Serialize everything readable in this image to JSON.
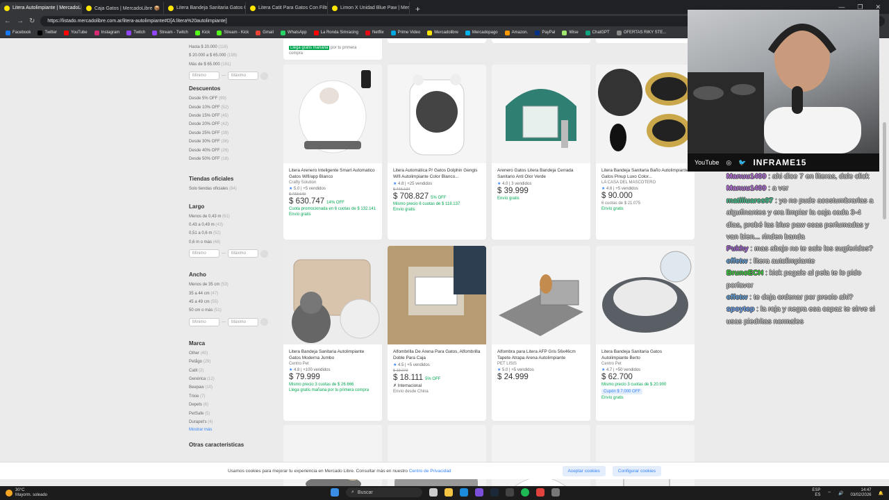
{
  "browser": {
    "tabs": [
      {
        "label": "Litera Autolimpiante | MercadoLi...",
        "active": true
      },
      {
        "label": "Caja Gatos | MercadoLibre 📦",
        "active": false
      },
      {
        "label": "Litera Bandeja Sanitaria Gatos Co...",
        "active": false
      },
      {
        "label": "Litera Catit Para Gatos Con Filtro A...",
        "active": false
      },
      {
        "label": "Limon X Unidad Blue Paw | Merca...",
        "active": false
      }
    ],
    "url": "https://listado.mercadolibre.com.ar/litera-autolimpiante#D[A:litera%20autolimpiante]",
    "bookmarks": [
      "Facebook",
      "Twitter",
      "YouTube",
      "Instagram",
      "Twitch",
      "Stream - Twitch",
      "Kick",
      "Stream - Kick",
      "Gmail",
      "WhatsApp",
      "La Ronda Simracing",
      "Netflix",
      "Prime Video",
      "Mercadolibre",
      "Mercadopago",
      "Amazon.",
      "PayPal",
      "Wise",
      "ChatGPT",
      "OFERTAS RIKY STE..."
    ],
    "bookmark_colors": [
      "#1877f2",
      "#000",
      "#f00",
      "#d62976",
      "#9146ff",
      "#9146ff",
      "#53fc18",
      "#53fc18",
      "#ea4335",
      "#25d366",
      "#f00",
      "#e50914",
      "#00a8e1",
      "#ffe600",
      "#00b1ea",
      "#ff9900",
      "#003087",
      "#9fe870",
      "#10a37f",
      "#888"
    ]
  },
  "filters": {
    "price_items": [
      {
        "label": "Hasta $ 20.000",
        "count": "(116)"
      },
      {
        "label": "$ 20.000 a $ 65.000",
        "count": "(199)"
      },
      {
        "label": "Más de $ 65.000",
        "count": "(161)"
      }
    ],
    "min_ph": "Mínimo",
    "max_ph": "Máximo",
    "discounts_title": "Descuentos",
    "discounts": [
      {
        "label": "Desde 5% OFF",
        "count": "(99)"
      },
      {
        "label": "Desde 10% OFF",
        "count": "(52)"
      },
      {
        "label": "Desde 15% OFF",
        "count": "(45)"
      },
      {
        "label": "Desde 20% OFF",
        "count": "(42)"
      },
      {
        "label": "Desde 25% OFF",
        "count": "(39)"
      },
      {
        "label": "Desde 30% OFF",
        "count": "(36)"
      },
      {
        "label": "Desde 40% OFF",
        "count": "(26)"
      },
      {
        "label": "Desde 50% OFF",
        "count": "(18)"
      }
    ],
    "official_title": "Tiendas oficiales",
    "official": {
      "label": "Solo tiendas oficiales",
      "count": "(84)"
    },
    "length_title": "Largo",
    "length": [
      {
        "label": "Menos de 0,43 m",
        "count": "(61)"
      },
      {
        "label": "0,43 a 0,49 m",
        "count": "(43)"
      },
      {
        "label": "0,51 a 0,6 m",
        "count": "(52)"
      },
      {
        "label": "0,6 m o más",
        "count": "(48)"
      }
    ],
    "width_title": "Ancho",
    "width": [
      {
        "label": "Menos de 35 cm",
        "count": "(53)"
      },
      {
        "label": "35 a 44 cm",
        "count": "(47)"
      },
      {
        "label": "45 a 49 cm",
        "count": "(55)"
      },
      {
        "label": "50 cm o más",
        "count": "(51)"
      }
    ],
    "brand_title": "Marca",
    "brands": [
      {
        "label": "Other",
        "count": "(40)"
      },
      {
        "label": "Petågo",
        "count": "(29)"
      },
      {
        "label": "Catit",
        "count": "(2)"
      },
      {
        "label": "Genérica",
        "count": "(12)"
      },
      {
        "label": "Beepaw",
        "count": "(10)"
      },
      {
        "label": "Trixie",
        "count": "(7)"
      },
      {
        "label": "Depets",
        "count": "(6)"
      },
      {
        "label": "PetSafe",
        "count": "(5)"
      },
      {
        "label": "Durapet's",
        "count": "(4)"
      }
    ],
    "more": "Mostrar más",
    "other_title": "Otras características"
  },
  "top_partial": {
    "shipping": "Llega gratis mañana",
    "shipping_rest": " por tu primera",
    "line2": "compra"
  },
  "products": [
    {
      "title": "Litera Arenero Inteligente Smart Automatico Gatos Wifi/app Blanco",
      "seller": "Crafty Solution",
      "rating": "5.0",
      "sold": "+5 vendidos",
      "old": "$ 733.640",
      "price": "$ 630.747",
      "off": "14% OFF",
      "l1": "Cuota promocionada en 6 cuotas de $ 132.141",
      "l1c": "green",
      "l2": "Envío gratis",
      "l2c": "green",
      "bg": "#f3f3f3"
    },
    {
      "title": "Litera Automática P/ Gatos Dolphin Gengis Wifi Autolimpiante Color Blanco...",
      "seller": "",
      "rating": "4.8",
      "sold": "+25 vendidos",
      "old": "$ 746.134",
      "price": "$ 708.827",
      "off": "5% OFF",
      "l1": "Mismo precio 6 cuotas de $ 118.137",
      "l1c": "green",
      "l2": "Envío gratis",
      "l2c": "green",
      "bg": "#f5f5f5"
    },
    {
      "title": "Arenero Gatos Litera Bandeja Cerrada Sanitario Anti Olor Verde",
      "seller": "",
      "rating": "4.0",
      "sold": "3 vendidos",
      "old": "",
      "price": "$ 39.999",
      "off": "",
      "l1": "Envío gratis",
      "l1c": "green",
      "l2": "",
      "l2c": "",
      "bg": "#f3f3f3"
    },
    {
      "title": "Litera Bandeja Sanitaria Baño Autolimpiante Gatos Pinup Luxo Color...",
      "seller": "LA CASA DEL MASCOTERO",
      "rating": "4.6",
      "sold": "+5 vendidos",
      "old": "",
      "price": "$ 90.000",
      "off": "",
      "l1": "6 cuotas de $ 21.075",
      "l1c": "gray",
      "l2": "Envío gratis",
      "l2c": "green",
      "bg": "#f3f3f3"
    },
    {
      "title": "Litera Bandeja Sanitaria Autolimpiante Gatos Moderna Jumbo",
      "seller": "Centro Pet",
      "rating": "4.8",
      "sold": "+100 vendidos",
      "old": "",
      "price": "$ 79.999",
      "off": "",
      "l1": "Mismo precio 3 cuotas de $ 26.666",
      "l1c": "green",
      "l2": "Llega gratis mañana por tu primera compra",
      "l2c": "green",
      "bg": "#ececec"
    },
    {
      "title": "Alfombrilla De Arena Para Gatos, Alfombrilla Doble Para Caja",
      "seller": "",
      "rating": "4.5",
      "sold": "+5 vendidos",
      "old": "$ 19.073",
      "price": "$ 18.111",
      "off": "5% OFF",
      "l1": "✗ Internacional",
      "l1c": "red",
      "l2": "Envío desde China",
      "l2c": "gray",
      "bg": "#b79b72"
    },
    {
      "title": "Alfombra para Litera AFP Gris 56x46cm Tapete Atrapa Arena Autolimpiante",
      "seller": "PET LISIS",
      "rating": "5.0",
      "sold": "+5 vendidos",
      "old": "",
      "price": "$ 24.999",
      "off": "",
      "l1": "",
      "l1c": "",
      "l2": "",
      "l2c": "",
      "bg": "#f3f3f3"
    },
    {
      "title": "Litera Bandeja Sanitaria Gatos Autolimpiante Berto",
      "seller": "Centro Pet",
      "rating": "4.7",
      "sold": "+50 vendidos",
      "old": "",
      "price": "$ 62.700",
      "off": "",
      "l1": "Mismo precio 3 cuotas de $ 20.900",
      "l1c": "green",
      "l2": "Envío gratis",
      "l2c": "green",
      "coupon": "Cupón $ 7.000 OFF",
      "bg": "#f3f3f3"
    }
  ],
  "cookie": {
    "text": "Usamos cookies para mejorar tu experiencia en Mercado Libre. Consultar más en nuestro ",
    "link": "Centro de Privacidad",
    "accept": "Aceptar cookies",
    "config": "Configurar cookies"
  },
  "taskbar": {
    "temp": "30°C",
    "weather": "Mayorm. soleado",
    "search": "Buscar",
    "lang1": "ESP",
    "lang2": "ES",
    "time": "14:47",
    "date": "03/02/2026"
  },
  "webcam": {
    "youtube": "YouTube",
    "channel": "INFRAME15"
  },
  "chat": [
    {
      "user": "Manuu1409",
      "color": "#b06ad8",
      "msg": "ahi dice 7 en literas, dale click"
    },
    {
      "user": "Manuu1409",
      "color": "#b06ad8",
      "msg": "a ver"
    },
    {
      "user": "matiliuares97",
      "color": "#3cc48a",
      "msg": "yo no pude acostumbrarlas a algufinantes y era limpiar la caja cada 3-4 dias, probé las blue paw esas perfumadas y van bien... rinden banda"
    },
    {
      "user": "Pukhy",
      "color": "#9b59d0",
      "msg": "mas abajo no te sale los sugferidos?"
    },
    {
      "user": "effetw",
      "color": "#5b9bd5",
      "msg": "litera autolimpiante"
    },
    {
      "user": "BrunoECH",
      "color": "#33cc33",
      "msg": "kick pagale al pela te lo pido porfavor"
    },
    {
      "user": "effetw",
      "color": "#5b9bd5",
      "msg": "te deja ordenar por precio ahi?"
    },
    {
      "user": "spoytep",
      "color": "#6aa0f0",
      "msg": "la roja y negra esa capaz te sirve si usas piedritas normales"
    }
  ]
}
